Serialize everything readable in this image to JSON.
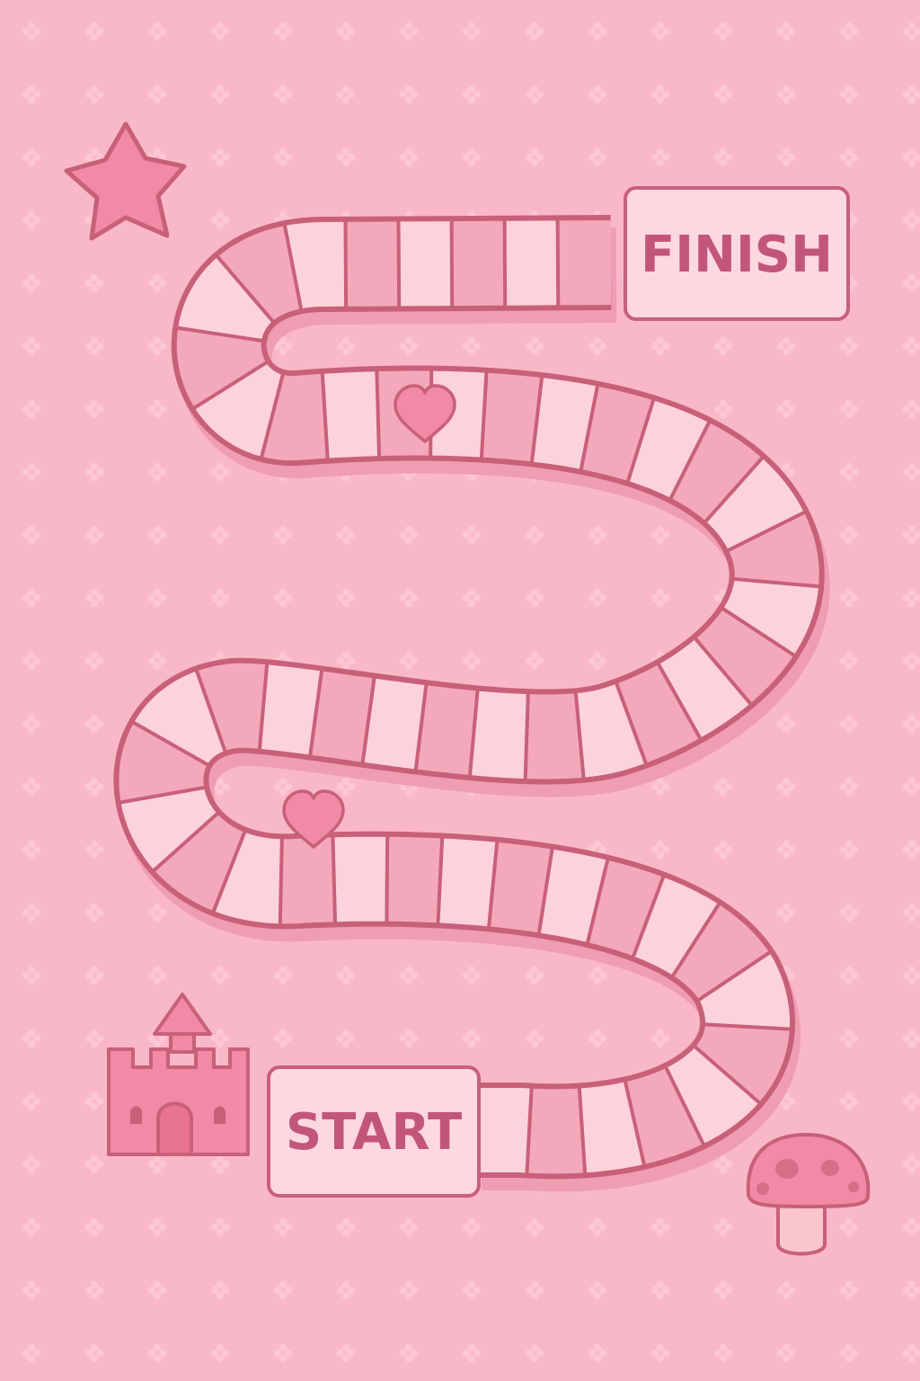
{
  "board": {
    "finish_label": "FINISH",
    "start_label": "START",
    "colors": {
      "background": "#f9b8c8",
      "pattern": "#fcc8d5",
      "outline": "#c8607a",
      "light_tile": "#fcd2dc",
      "dark_tile": "#f4a8bb",
      "label_fill": "#fcd8e1",
      "label_text": "#c2567a"
    },
    "decorations": [
      "star-icon",
      "heart-icon",
      "heart-icon",
      "castle-icon",
      "mushroom-icon"
    ],
    "spaces": 54
  }
}
